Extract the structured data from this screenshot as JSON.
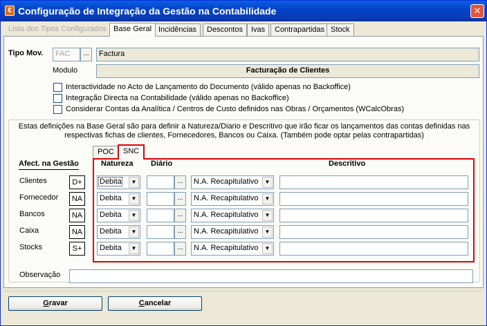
{
  "window": {
    "title": "Configuração de Integração da Gestão na Contabilidade",
    "icon": "app-icon",
    "close_label": "✕"
  },
  "tabs": [
    {
      "label": "Lista dos Tipos Configurados",
      "state": "disabled"
    },
    {
      "label": "Base Geral",
      "state": "active"
    },
    {
      "label": "Incidências",
      "state": "normal"
    },
    {
      "label": "Descontos",
      "state": "normal"
    },
    {
      "label": "Ivas",
      "state": "normal"
    },
    {
      "label": "Contrapartidas",
      "state": "normal"
    },
    {
      "label": "Stock",
      "state": "normal"
    }
  ],
  "tipo_mov": {
    "label": "Tipo Mov.",
    "code": "FAC",
    "browse_label": "...",
    "description": "Factura"
  },
  "modulo": {
    "label": "Modulo",
    "value": "Facturação de Clientes"
  },
  "options": [
    {
      "label": "Interactividade no Acto de Lançamento do Documento (válido apenas no Backoffice)",
      "checked": false
    },
    {
      "label": "Integração Directa na Contabilidade (válido apenas no Backoffice)",
      "checked": false
    },
    {
      "label": "Considerar Contas da Analítica / Centros de Custo definidos nas Obras / Orçamentos (WCalcObras)",
      "checked": false
    }
  ],
  "group_desc": {
    "line1": "Estas definições na Base Geral são para definir a Natureza/Diario e Descritivo que irão ficar os lançamentos das contas definidas nas",
    "line2": "respectivas fichas de clientes, Fornecedores, Bancos ou Caixa. (Também pode optar pelas contrapartidas)"
  },
  "subtabs": [
    {
      "label": "POC",
      "state": "normal"
    },
    {
      "label": "SNC",
      "state": "active"
    }
  ],
  "grid": {
    "afect_title": "Afect. na Gestão",
    "headers": {
      "natureza": "Natureza",
      "diario": "Diário",
      "descritivo": "Descritivo"
    },
    "rows": [
      {
        "entity": "Clientes",
        "code": "D+",
        "natureza": "Debita",
        "diario": "",
        "resumo": "N.A. Recapitulativo",
        "descritivo": "",
        "focused": true
      },
      {
        "entity": "Fornecedor",
        "code": "NA",
        "natureza": "Debita",
        "diario": "",
        "resumo": "N.A. Recapitulativo",
        "descritivo": "",
        "focused": false
      },
      {
        "entity": "Bancos",
        "code": "NA",
        "natureza": "Debita",
        "diario": "",
        "resumo": "N.A. Recapitulativo",
        "descritivo": "",
        "focused": false
      },
      {
        "entity": "Caixa",
        "code": "NA",
        "natureza": "Debita",
        "diario": "",
        "resumo": "N.A. Recapitulativo",
        "descritivo": "",
        "focused": false
      },
      {
        "entity": "Stocks",
        "code": "S+",
        "natureza": "Debita",
        "diario": "",
        "resumo": "N.A. Recapitulativo",
        "descritivo": "",
        "focused": false
      }
    ],
    "browse_label": "..."
  },
  "observacao": {
    "label": "Observação",
    "value": ""
  },
  "buttons": {
    "gravar_pre": "",
    "gravar_u": "G",
    "gravar_post": "ravar",
    "cancelar_pre": "",
    "cancelar_u": "C",
    "cancelar_post": "ancelar"
  },
  "colors": {
    "accent": "#0a5fe4",
    "highlight_border": "#e00000",
    "face": "#ece9d8"
  }
}
